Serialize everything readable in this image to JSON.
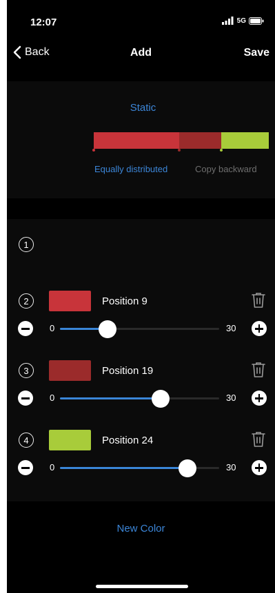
{
  "status_bar": {
    "time": "12:07",
    "network": "5G",
    "icons": [
      "signal-icon",
      "battery-icon"
    ]
  },
  "nav": {
    "back_label": "Back",
    "title": "Add",
    "save_label": "Save"
  },
  "mode": {
    "label": "Static"
  },
  "gradient": {
    "segments": [
      {
        "color": "#c8343a",
        "weight": 0.49
      },
      {
        "color": "#9b2b2b",
        "weight": 0.24
      },
      {
        "color": "#a8cc3a",
        "weight": 0.27
      }
    ]
  },
  "actions": {
    "equally_distributed": "Equally distributed",
    "copy_backward": "Copy backward"
  },
  "colors": [
    {
      "index": "1"
    },
    {
      "index": "2",
      "color": "#c8343a",
      "label": "Position 9",
      "min": "0",
      "max": "30",
      "value": 9
    },
    {
      "index": "3",
      "color": "#9b2b2b",
      "label": "Position 19",
      "min": "0",
      "max": "30",
      "value": 19
    },
    {
      "index": "4",
      "color": "#a8cc3a",
      "label": "Position 24",
      "min": "0",
      "max": "30",
      "value": 24
    }
  ],
  "footer": {
    "new_color_label": "New Color"
  },
  "theme": {
    "accent": "#3c86d8",
    "background": "#000000",
    "panel": "#0b0b0b"
  }
}
